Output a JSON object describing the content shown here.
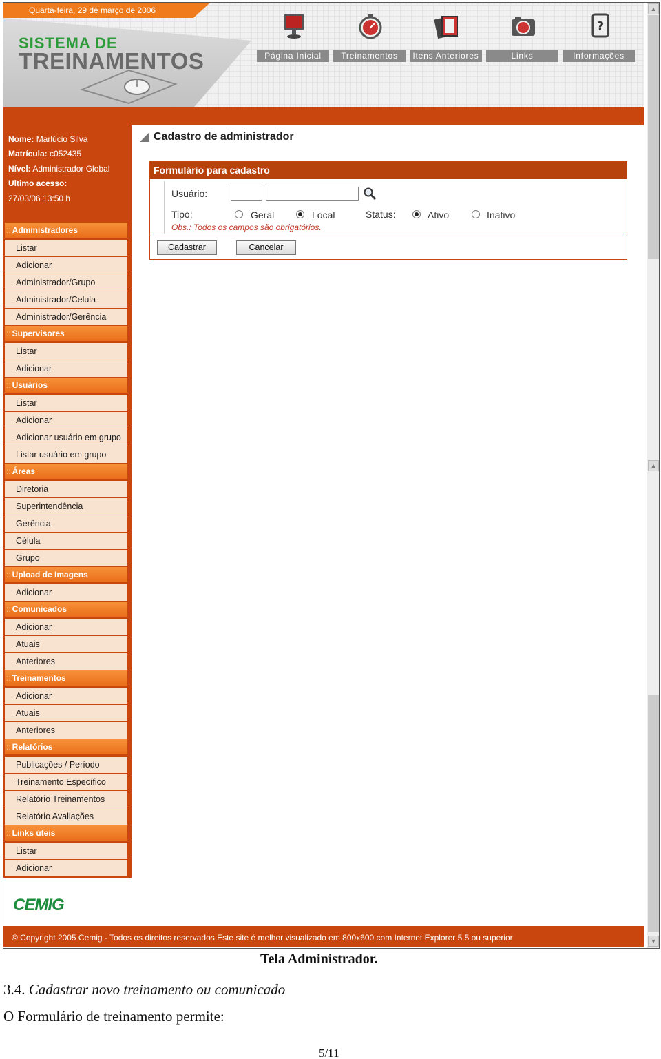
{
  "header": {
    "date": "Quarta-feira, 29 de março de 2006",
    "logo_line1": "SISTEMA DE",
    "logo_line2": "TREINAMENTOS",
    "nav": [
      {
        "label": "Página Inicial",
        "icon": "monitor-icon"
      },
      {
        "label": "Treinamentos",
        "icon": "stopwatch-icon"
      },
      {
        "label": "Itens Anteriores",
        "icon": "cards-icon"
      },
      {
        "label": "Links",
        "icon": "camera-icon"
      },
      {
        "label": "Informações",
        "icon": "help-book-icon"
      }
    ]
  },
  "user": {
    "name_label": "Nome:",
    "name": "Marlúcio Silva",
    "id_label": "Matrícula:",
    "id": "c052435",
    "level_label": "Nível:",
    "level": "Administrador Global",
    "last_access_label": "Ultimo acesso:",
    "last_access": "27/03/06 13:50 h"
  },
  "sidebar": {
    "prefix": "::",
    "sections": [
      {
        "title": "Administradores",
        "items": [
          "Listar",
          "Adicionar",
          "Administrador/Grupo",
          "Administrador/Celula",
          "Administrador/Gerência"
        ]
      },
      {
        "title": "Supervisores",
        "items": [
          "Listar",
          "Adicionar"
        ]
      },
      {
        "title": "Usuários",
        "items": [
          "Listar",
          "Adicionar",
          "Adicionar usuário em grupo",
          "Listar usuário em grupo"
        ]
      },
      {
        "title": "Áreas",
        "items": [
          "Diretoria",
          "Superintendência",
          "Gerência",
          "Célula",
          "Grupo"
        ]
      },
      {
        "title": "Upload de Imagens",
        "items": [
          "Adicionar"
        ]
      },
      {
        "title": "Comunicados",
        "items": [
          "Adicionar",
          "Atuais",
          "Anteriores"
        ]
      },
      {
        "title": "Treinamentos",
        "items": [
          "Adicionar",
          "Atuais",
          "Anteriores"
        ]
      },
      {
        "title": "Relatórios",
        "items": [
          "Publicações / Período",
          "Treinamento Específico",
          "Relatório Treinamentos",
          "Relatório Avaliações"
        ]
      },
      {
        "title": "Links úteis",
        "items": [
          "Listar",
          "Adicionar"
        ]
      }
    ]
  },
  "main": {
    "page_title": "Cadastro de administrador",
    "form_title": "Formulário para cadastro",
    "usuario_label": "Usuário:",
    "usuario_code_value": "",
    "usuario_name_value": "",
    "tipo_label": "Tipo:",
    "tipo_options": [
      "Geral",
      "Local"
    ],
    "tipo_selected": "Local",
    "status_label": "Status:",
    "status_options": [
      "Ativo",
      "Inativo"
    ],
    "status_selected": "Ativo",
    "obs": "Obs.: Todos os campos são obrigatórios.",
    "submit_label": "Cadastrar",
    "cancel_label": "Cancelar"
  },
  "footer": {
    "logo": "CEMIG",
    "copyright": "© Copyright 2005 Cemig - Todos os direitos reservados Este site é melhor visualizado em 800x600 com Internet Explorer 5.5 ou superior"
  },
  "document": {
    "caption": "Tela Administrador.",
    "section_number": "3.4.",
    "section_title": "Cadastrar novo treinamento ou comunicado",
    "paragraph": "O Formulário de treinamento permite:",
    "page_number": "5/11"
  },
  "colors": {
    "brand_dark": "#c9460e",
    "brand_light": "#f7923a",
    "logo_green": "#2d9b3a"
  }
}
